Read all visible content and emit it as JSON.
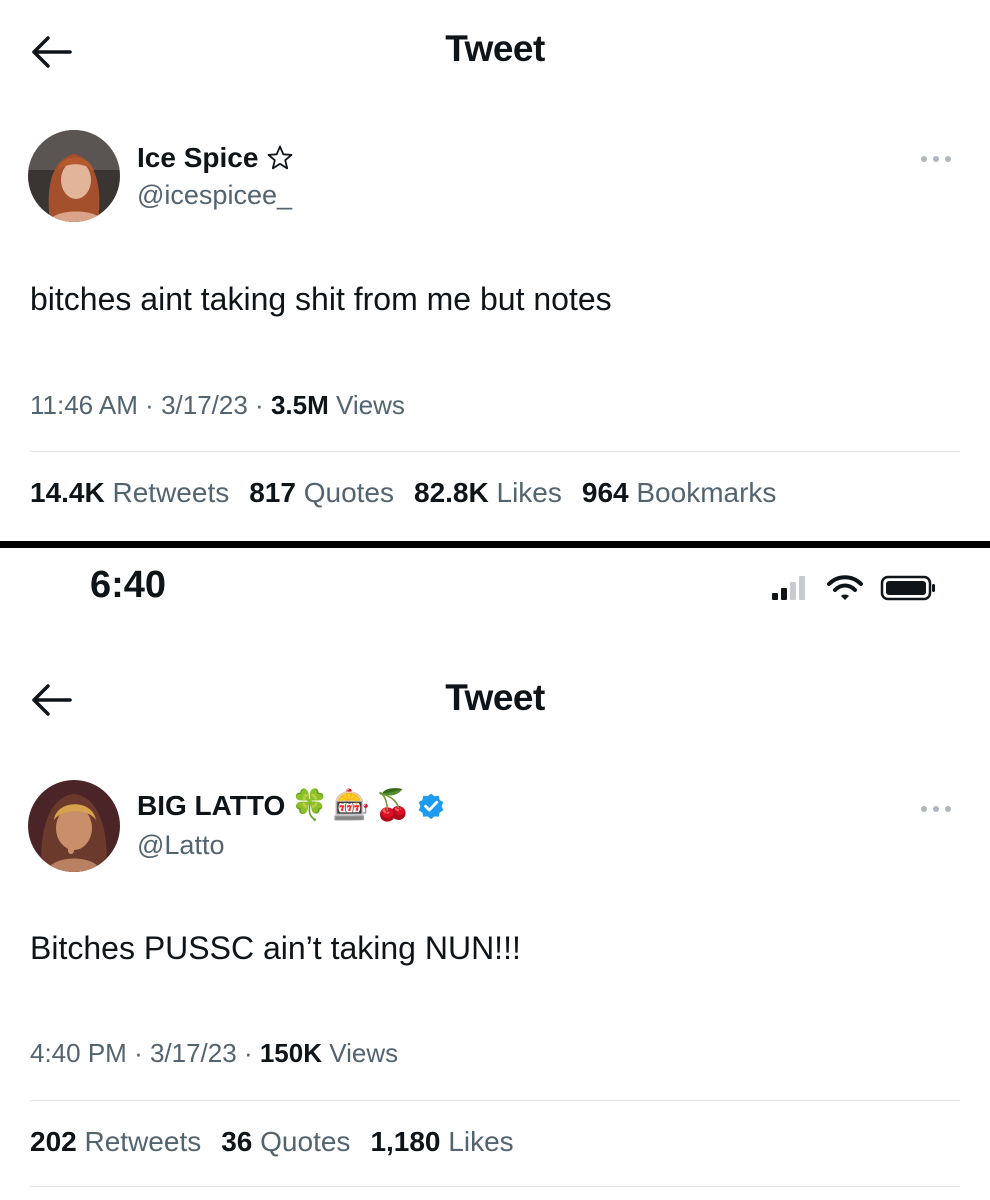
{
  "top_tweet": {
    "header_title": "Tweet",
    "back_icon": "back-arrow-icon",
    "author_name": "Ice Spice",
    "author_name_icon": "star-outline-icon",
    "author_handle": "@icespicee_",
    "text": "bitches aint taking shit from me but notes",
    "time": "11:46 AM",
    "date": "3/17/23",
    "views_count": "3.5M",
    "views_label": "Views",
    "stats": [
      {
        "count": "14.4K",
        "label": "Retweets"
      },
      {
        "count": "817",
        "label": "Quotes"
      },
      {
        "count": "82.8K",
        "label": "Likes"
      },
      {
        "count": "964",
        "label": "Bookmarks"
      }
    ]
  },
  "bottom_tweet": {
    "status_time": "6:40",
    "header_title": "Tweet",
    "author_name": "BIG LATTO",
    "author_emojis": [
      "🍀",
      "🎰",
      "🍒"
    ],
    "verified": true,
    "author_handle": "@Latto",
    "text": "Bitches PUSSC ain’t taking NUN!!!",
    "time": "4:40 PM",
    "date": "3/17/23",
    "views_count": "150K",
    "views_label": "Views",
    "stats": [
      {
        "count": "202",
        "label": "Retweets"
      },
      {
        "count": "36",
        "label": "Quotes"
      },
      {
        "count": "1,180",
        "label": "Likes"
      }
    ]
  },
  "colors": {
    "text_primary": "#0f1419",
    "text_secondary": "#536471",
    "verified_blue": "#1d9bf0",
    "divider": "#000000"
  }
}
